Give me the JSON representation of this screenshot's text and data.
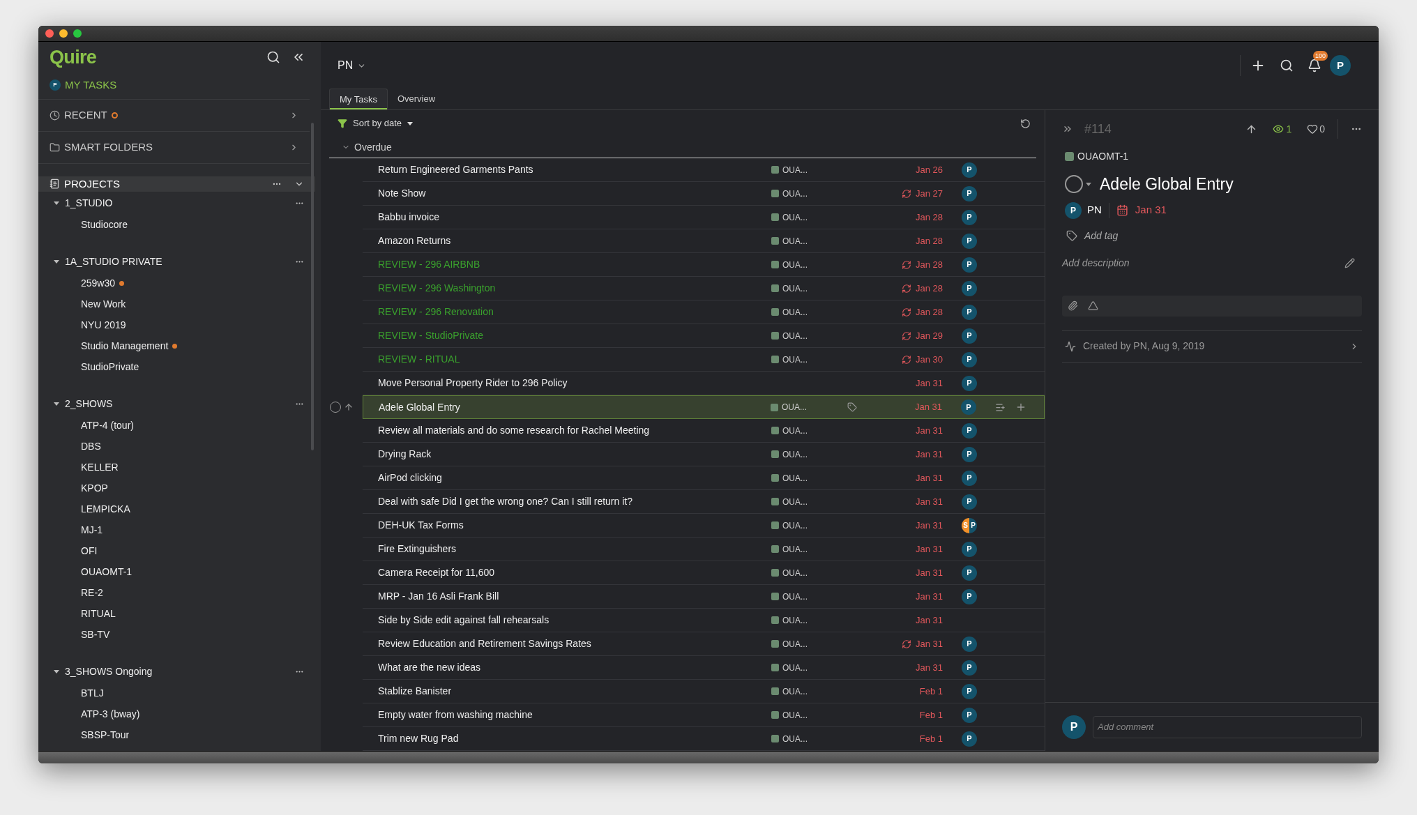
{
  "sidebar": {
    "logo": "Quire",
    "my_tasks": {
      "label": "MY TASKS",
      "avatar": "P"
    },
    "sections": [
      {
        "label": "RECENT",
        "indicator": true
      },
      {
        "label": "SMART FOLDERS",
        "indicator": false
      }
    ],
    "projects": {
      "label": "PROJECTS",
      "expanded": true
    },
    "groups": [
      {
        "name": "1_STUDIO",
        "expanded": true,
        "children": [
          {
            "name": "Studiocore",
            "updated": false
          }
        ]
      },
      {
        "name": "1A_STUDIO PRIVATE",
        "expanded": true,
        "children": [
          {
            "name": "259w30",
            "updated": true
          },
          {
            "name": "New Work",
            "updated": false
          },
          {
            "name": "NYU 2019",
            "updated": false
          },
          {
            "name": "Studio Management",
            "updated": true
          },
          {
            "name": "StudioPrivate",
            "updated": false
          }
        ]
      },
      {
        "name": "2_SHOWS",
        "expanded": true,
        "children": [
          {
            "name": "ATP-4 (tour)",
            "updated": false
          },
          {
            "name": "DBS",
            "updated": false
          },
          {
            "name": "KELLER",
            "updated": false
          },
          {
            "name": "KPOP",
            "updated": false
          },
          {
            "name": "LEMPICKA",
            "updated": false
          },
          {
            "name": "MJ-1",
            "updated": false
          },
          {
            "name": "OFI",
            "updated": false
          },
          {
            "name": "OUAOMT-1",
            "updated": false
          },
          {
            "name": "RE-2",
            "updated": false
          },
          {
            "name": "RITUAL",
            "updated": false
          },
          {
            "name": "SB-TV",
            "updated": false
          }
        ]
      },
      {
        "name": "3_SHOWS Ongoing",
        "expanded": true,
        "children": [
          {
            "name": "BTLJ",
            "updated": false
          },
          {
            "name": "ATP-3 (bway)",
            "updated": false
          },
          {
            "name": "SBSP-Tour",
            "updated": false
          }
        ]
      }
    ]
  },
  "header": {
    "workspace": "PN",
    "notifications": "100",
    "avatar": "P"
  },
  "tabs": [
    {
      "label": "My Tasks",
      "selected": true
    },
    {
      "label": "Overview",
      "selected": false
    }
  ],
  "sort": "Sort by date",
  "section": {
    "label": "Overdue",
    "expanded": true
  },
  "tasks": [
    {
      "title": "Return Engineered Garments Pants",
      "kind": "task",
      "project": "OUA...",
      "recurring": false,
      "date": "Jan 26",
      "assignees": [
        "P"
      ],
      "selected": false
    },
    {
      "title": "Note Show",
      "kind": "task",
      "project": "OUA...",
      "recurring": true,
      "date": "Jan 27",
      "assignees": [
        "P"
      ],
      "selected": false
    },
    {
      "title": "Babbu invoice",
      "kind": "task",
      "project": "OUA...",
      "recurring": false,
      "date": "Jan 28",
      "assignees": [
        "P"
      ],
      "selected": false
    },
    {
      "title": "Amazon Returns",
      "kind": "task",
      "project": "OUA...",
      "recurring": false,
      "date": "Jan 28",
      "assignees": [
        "P"
      ],
      "selected": false
    },
    {
      "title": "REVIEW - 296 AIRBNB",
      "kind": "review",
      "project": "OUA...",
      "recurring": true,
      "date": "Jan 28",
      "assignees": [
        "P"
      ],
      "selected": false
    },
    {
      "title": "REVIEW - 296 Washington",
      "kind": "review",
      "project": "OUA...",
      "recurring": true,
      "date": "Jan 28",
      "assignees": [
        "P"
      ],
      "selected": false
    },
    {
      "title": "REVIEW - 296 Renovation",
      "kind": "review",
      "project": "OUA...",
      "recurring": true,
      "date": "Jan 28",
      "assignees": [
        "P"
      ],
      "selected": false
    },
    {
      "title": "REVIEW - StudioPrivate",
      "kind": "review",
      "project": "OUA...",
      "recurring": true,
      "date": "Jan 29",
      "assignees": [
        "P"
      ],
      "selected": false
    },
    {
      "title": "REVIEW - RITUAL",
      "kind": "review",
      "project": "OUA...",
      "recurring": true,
      "date": "Jan 30",
      "assignees": [
        "P"
      ],
      "selected": false
    },
    {
      "title": "Move Personal Property Rider to 296 Policy",
      "kind": "task",
      "recurring": false,
      "date": "Jan 31",
      "assignees": [
        "P"
      ],
      "selected": false
    },
    {
      "title": "Adele Global Entry",
      "kind": "task",
      "project": "OUA...",
      "recurring": false,
      "date": "Jan 31",
      "assignees": [
        "P"
      ],
      "selected": true
    },
    {
      "title": "Review all materials and do some research for Rachel Meeting",
      "kind": "task",
      "project": "OUA...",
      "recurring": false,
      "date": "Jan 31",
      "assignees": [
        "P"
      ],
      "selected": false
    },
    {
      "title": "Drying Rack",
      "kind": "task",
      "project": "OUA...",
      "recurring": false,
      "date": "Jan 31",
      "assignees": [
        "P"
      ],
      "selected": false
    },
    {
      "title": "AirPod clicking",
      "kind": "task",
      "project": "OUA...",
      "recurring": false,
      "date": "Jan 31",
      "assignees": [
        "P"
      ],
      "selected": false
    },
    {
      "title": "Deal with safe Did I get the wrong one? Can I still return it?",
      "kind": "task",
      "project": "OUA...",
      "recurring": false,
      "date": "Jan 31",
      "assignees": [
        "P"
      ],
      "selected": false
    },
    {
      "title": "DEH-UK Tax Forms",
      "kind": "task",
      "project": "OUA...",
      "recurring": false,
      "date": "Jan 31",
      "assignees": [
        "S",
        "P"
      ],
      "selected": false
    },
    {
      "title": "Fire Extinguishers",
      "kind": "task",
      "project": "OUA...",
      "recurring": false,
      "date": "Jan 31",
      "assignees": [
        "P"
      ],
      "selected": false
    },
    {
      "title": "Camera Receipt for 11,600",
      "kind": "task",
      "project": "OUA...",
      "recurring": false,
      "date": "Jan 31",
      "assignees": [
        "P"
      ],
      "selected": false
    },
    {
      "title": "MRP - Jan 16 Asli Frank Bill",
      "kind": "task",
      "project": "OUA...",
      "recurring": false,
      "date": "Jan 31",
      "assignees": [
        "P"
      ],
      "selected": false
    },
    {
      "title": "Side by Side edit against fall rehearsals",
      "kind": "task",
      "project": "OUA...",
      "recurring": false,
      "date": "Jan 31",
      "selected": false
    },
    {
      "title": "Review Education and Retirement Savings Rates",
      "kind": "task",
      "project": "OUA...",
      "recurring": true,
      "date": "Jan 31",
      "assignees": [
        "P"
      ],
      "selected": false
    },
    {
      "title": "What are the new ideas",
      "kind": "task",
      "project": "OUA...",
      "recurring": false,
      "date": "Jan 31",
      "assignees": [
        "P"
      ],
      "selected": false
    },
    {
      "title": "Stablize Banister",
      "kind": "task",
      "project": "OUA...",
      "recurring": false,
      "date": "Feb 1",
      "assignees": [
        "P"
      ],
      "selected": false
    },
    {
      "title": "Empty water from washing machine",
      "kind": "task",
      "project": "OUA...",
      "recurring": false,
      "date": "Feb 1",
      "assignees": [
        "P"
      ],
      "selected": false
    },
    {
      "title": "Trim new Rug Pad",
      "kind": "task",
      "project": "OUA...",
      "recurring": false,
      "date": "Feb 1",
      "assignees": [
        "P"
      ],
      "selected": false
    }
  ],
  "detail": {
    "id": "#114",
    "watchers": "1",
    "likes": "0",
    "project": "OUAOMT-1",
    "title": "Adele Global Entry",
    "assignee": {
      "avatar": "P",
      "name": "PN"
    },
    "due": "Jan 31",
    "tag_placeholder": "Add tag",
    "description_placeholder": "Add description",
    "activity": "Created by PN, Aug 9, 2019",
    "comment": {
      "avatar": "P",
      "placeholder": "Add comment"
    }
  }
}
